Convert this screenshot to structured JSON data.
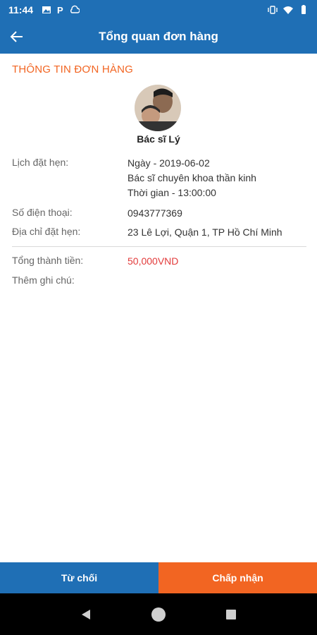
{
  "status_bar": {
    "time": "11:44",
    "left_icons": [
      "image-icon",
      "parking-icon",
      "cloud-icon"
    ],
    "right_icons": [
      "vibrate-icon",
      "wifi-icon",
      "battery-icon"
    ]
  },
  "app_bar": {
    "title": "Tổng quan đơn hàng",
    "back_icon": "arrow-left-icon"
  },
  "order": {
    "section_title": "THÔNG TIN ĐƠN HÀNG",
    "doctor_name": "Bác sĩ Lý",
    "appointment": {
      "label": "Lịch đặt hẹn:",
      "date": "Ngày - 2019-06-02",
      "specialty": "Bác sĩ chuyên khoa thần kinh",
      "time": "Thời gian - 13:00:00"
    },
    "phone": {
      "label": "Số điện thoại:",
      "value": "0943777369"
    },
    "address": {
      "label": "Địa chỉ đặt hẹn:",
      "value": "23 Lê Lợi, Quận 1, TP Hồ Chí Minh"
    },
    "total": {
      "label": "Tổng thành tiền:",
      "value": "50,000VND"
    },
    "note": {
      "label": "Thêm ghi chú:"
    }
  },
  "actions": {
    "reject_label": "Từ chối",
    "accept_label": "Chấp nhận"
  },
  "colors": {
    "primary": "#1f6fb5",
    "accent": "#f26522",
    "price": "#e23b3b"
  },
  "system_nav": [
    "back-triangle-icon",
    "home-circle-icon",
    "recents-square-icon"
  ]
}
